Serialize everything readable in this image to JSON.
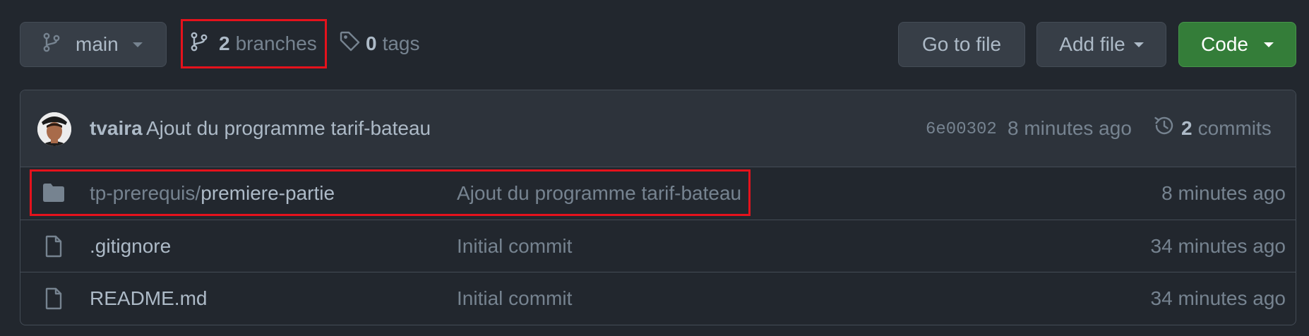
{
  "toolbar": {
    "branch_selector": {
      "label": "main"
    },
    "branches": {
      "count": "2",
      "label": "branches"
    },
    "tags": {
      "count": "0",
      "label": "tags"
    },
    "go_to_file_label": "Go to file",
    "add_file_label": "Add file",
    "code_label": "Code",
    "code_button_color": "#347d39"
  },
  "latest_commit": {
    "author": "tvaira",
    "message": "Ajout du programme tarif-bateau",
    "sha": "6e00302",
    "time": "8 minutes ago",
    "commits_count": "2",
    "commits_label": "commits"
  },
  "files": [
    {
      "type": "directory",
      "icon": "folder-icon",
      "name_prefix": "tp-prerequis/",
      "name": "premiere-partie",
      "message": "Ajout du programme tarif-bateau",
      "time": "8 minutes ago"
    },
    {
      "type": "file",
      "icon": "file-icon",
      "name": ".gitignore",
      "message": "Initial commit",
      "time": "34 minutes ago"
    },
    {
      "type": "file",
      "icon": "file-icon",
      "name": "README.md",
      "message": "Initial commit",
      "time": "34 minutes ago"
    }
  ],
  "colors": {
    "background": "#22272e",
    "highlight": "#e5121c",
    "text": "#adbac7",
    "muted": "#768390"
  }
}
